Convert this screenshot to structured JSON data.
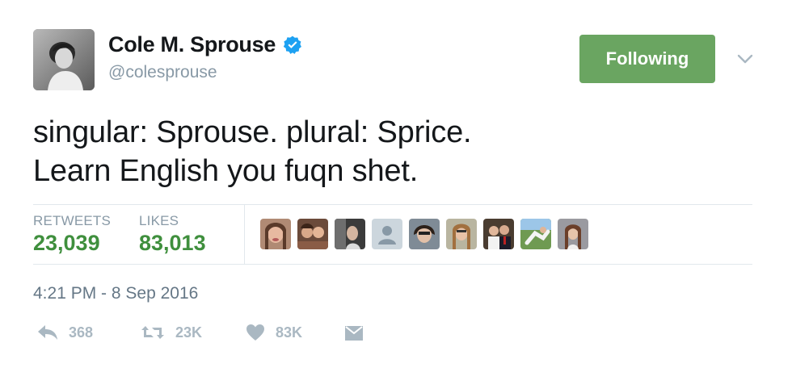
{
  "author": {
    "display_name": "Cole M. Sprouse",
    "handle": "@colesprouse",
    "verified": true,
    "avatar_icon": "profile-photo"
  },
  "follow_button": {
    "label": "Following",
    "color": "#6aa561"
  },
  "menu": {
    "icon": "chevron-down-icon"
  },
  "tweet": {
    "lines": [
      "singular: Sprouse. plural: Sprice.",
      "Learn English you fuqn shet."
    ]
  },
  "stats": {
    "retweets_label": "RETWEETS",
    "retweets_value": "23,039",
    "likes_label": "LIKES",
    "likes_value": "83,013",
    "value_color": "#3f8f3d"
  },
  "likers": [
    {
      "icon": "liker-avatar-1"
    },
    {
      "icon": "liker-avatar-2"
    },
    {
      "icon": "liker-avatar-3"
    },
    {
      "icon": "default-egg-avatar"
    },
    {
      "icon": "liker-avatar-5"
    },
    {
      "icon": "liker-avatar-6"
    },
    {
      "icon": "liker-avatar-7"
    },
    {
      "icon": "liker-avatar-8"
    },
    {
      "icon": "liker-avatar-9"
    }
  ],
  "timestamp": "4:21 PM - 8 Sep 2016",
  "actions": {
    "reply_count": "368",
    "retweet_count": "23K",
    "like_count": "83K",
    "reply_icon": "reply-icon",
    "retweet_icon": "retweet-icon",
    "like_icon": "heart-icon",
    "dm_icon": "direct-message-icon"
  }
}
